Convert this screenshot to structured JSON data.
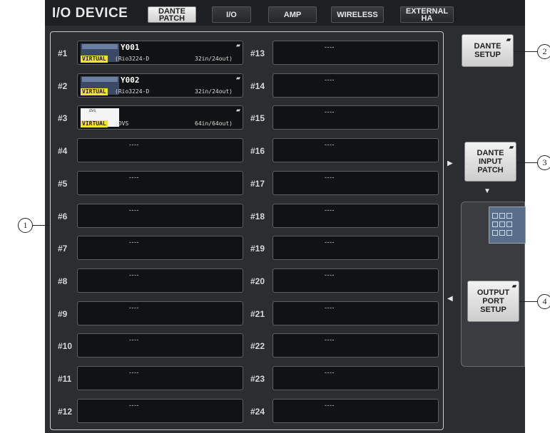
{
  "title": "I/O DEVICE",
  "tabs": [
    {
      "label": "DANTE\nPATCH",
      "active": true
    },
    {
      "label": "I/O",
      "active": false
    },
    {
      "label": "AMP",
      "active": false
    },
    {
      "label": "WIRELESS",
      "active": false
    },
    {
      "label": "EXTERNAL\nHA",
      "active": false
    }
  ],
  "slots": [
    {
      "num": "#1",
      "name": "Y001",
      "model": "(Rio3224-D",
      "io": "32in/24out)",
      "virtual": "VIRTUAL",
      "thumb": "Rio3224"
    },
    {
      "num": "#2",
      "name": "Y002",
      "model": "(Rio3224-D",
      "io": "32in/24out)",
      "virtual": "VIRTUAL",
      "thumb": "Rio3224"
    },
    {
      "num": "#3",
      "name": "",
      "model": "(DVS",
      "io": "64in/64out)",
      "virtual": "VIRTUAL",
      "thumb": "dvs"
    },
    {
      "num": "#4",
      "empty": "----"
    },
    {
      "num": "#5",
      "empty": "----"
    },
    {
      "num": "#6",
      "empty": "----"
    },
    {
      "num": "#7",
      "empty": "----"
    },
    {
      "num": "#8",
      "empty": "----"
    },
    {
      "num": "#9",
      "empty": "----"
    },
    {
      "num": "#10",
      "empty": "----"
    },
    {
      "num": "#11",
      "empty": "----"
    },
    {
      "num": "#12",
      "empty": "----"
    },
    {
      "num": "#13",
      "empty": "----"
    },
    {
      "num": "#14",
      "empty": "----"
    },
    {
      "num": "#15",
      "empty": "----"
    },
    {
      "num": "#16",
      "empty": "----"
    },
    {
      "num": "#17",
      "empty": "----"
    },
    {
      "num": "#18",
      "empty": "----"
    },
    {
      "num": "#19",
      "empty": "----"
    },
    {
      "num": "#20",
      "empty": "----"
    },
    {
      "num": "#21",
      "empty": "----"
    },
    {
      "num": "#22",
      "empty": "----"
    },
    {
      "num": "#23",
      "empty": "----"
    },
    {
      "num": "#24",
      "empty": "----"
    }
  ],
  "buttons": {
    "dante_setup": "DANTE\nSETUP",
    "dante_input_patch": "DANTE\nINPUT\nPATCH",
    "output_port_setup": "OUTPUT\nPORT\nSETUP"
  },
  "callouts": [
    "1",
    "2",
    "3",
    "4"
  ],
  "icons": {
    "popup": "popup-corner-icon",
    "arrow_right": "triangle-right-icon",
    "arrow_down": "triangle-down-icon",
    "arrow_left": "triangle-left-icon"
  }
}
